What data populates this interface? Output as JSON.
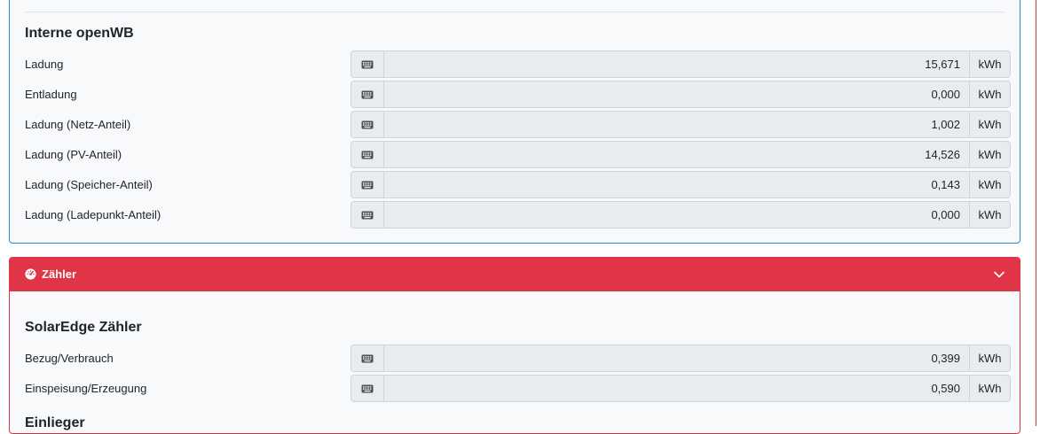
{
  "internal": {
    "title": "Interne openWB",
    "rows": [
      {
        "label": "Ladung",
        "value": "15,671",
        "unit": "kWh"
      },
      {
        "label": "Entladung",
        "value": "0,000",
        "unit": "kWh"
      },
      {
        "label": "Ladung (Netz-Anteil)",
        "value": "1,002",
        "unit": "kWh"
      },
      {
        "label": "Ladung (PV-Anteil)",
        "value": "14,526",
        "unit": "kWh"
      },
      {
        "label": "Ladung (Speicher-Anteil)",
        "value": "0,143",
        "unit": "kWh"
      },
      {
        "label": "Ladung (Ladepunkt-Anteil)",
        "value": "0,000",
        "unit": "kWh"
      }
    ]
  },
  "meter_card": {
    "header": "Zähler",
    "header_icon": "gauge-icon",
    "collapse_icon": "chevron-down-icon",
    "accent_color": "#df3546",
    "section_title": "SolarEdge Zähler",
    "rows": [
      {
        "label": "Bezug/Verbrauch",
        "value": "0,399",
        "unit": "kWh"
      },
      {
        "label": "Einspeisung/Erzeugung",
        "value": "0,590",
        "unit": "kWh"
      }
    ],
    "next_section_title": "Einlieger"
  },
  "icons": {
    "input_prefix": "keyboard-icon"
  }
}
